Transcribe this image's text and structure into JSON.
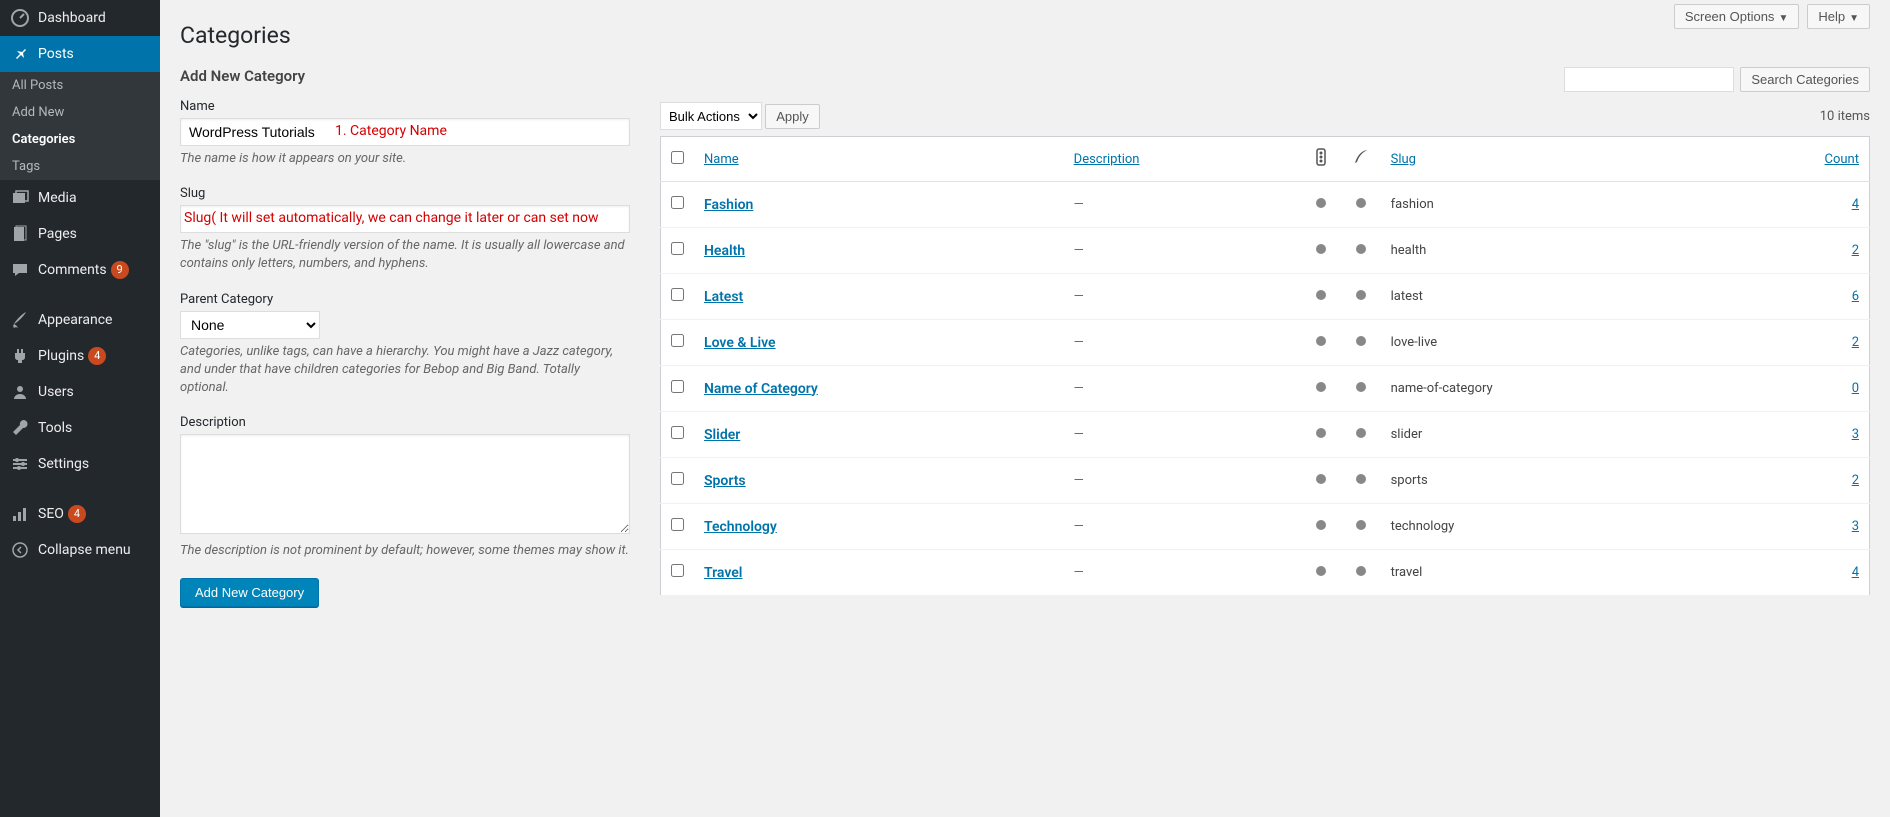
{
  "topbar": {
    "screen_options": "Screen Options",
    "help": "Help"
  },
  "sidebar": {
    "dashboard": "Dashboard",
    "posts": "Posts",
    "posts_sub": {
      "all": "All Posts",
      "add": "Add New",
      "categories": "Categories",
      "tags": "Tags"
    },
    "media": "Media",
    "pages": "Pages",
    "comments": "Comments",
    "comments_badge": "9",
    "appearance": "Appearance",
    "plugins": "Plugins",
    "plugins_badge": "4",
    "users": "Users",
    "tools": "Tools",
    "settings": "Settings",
    "seo": "SEO",
    "seo_badge": "4",
    "collapse": "Collapse menu"
  },
  "page": {
    "title": "Categories"
  },
  "form": {
    "heading": "Add New Category",
    "name_label": "Name",
    "name_value": "WordPress Tutorials",
    "name_annot": "1. Category Name",
    "name_desc": "The name is how it appears on your site.",
    "slug_label": "Slug",
    "slug_annot": "Slug( It will set automatically, we can change it later or can set now",
    "slug_desc": "The \"slug\" is the URL-friendly version of the name. It is usually all lowercase and contains only letters, numbers, and hyphens.",
    "parent_label": "Parent Category",
    "parent_value": "None",
    "parent_desc": "Categories, unlike tags, can have a hierarchy. You might have a Jazz category, and under that have children categories for Bebop and Big Band. Totally optional.",
    "desc_label": "Description",
    "desc_desc": "The description is not prominent by default; however, some themes may show it.",
    "submit": "Add New Category"
  },
  "table": {
    "search_btn": "Search Categories",
    "bulk_label": "Bulk Actions",
    "apply": "Apply",
    "total": "10 items",
    "cols": {
      "name": "Name",
      "description": "Description",
      "slug": "Slug",
      "count": "Count"
    },
    "rows": [
      {
        "name": "Fashion",
        "desc": "—",
        "slug": "fashion",
        "count": "4"
      },
      {
        "name": "Health",
        "desc": "—",
        "slug": "health",
        "count": "2"
      },
      {
        "name": "Latest",
        "desc": "—",
        "slug": "latest",
        "count": "6"
      },
      {
        "name": "Love & Live",
        "desc": "—",
        "slug": "love-live",
        "count": "2"
      },
      {
        "name": "Name of Category",
        "desc": "—",
        "slug": "name-of-category",
        "count": "0"
      },
      {
        "name": "Slider",
        "desc": "—",
        "slug": "slider",
        "count": "3"
      },
      {
        "name": "Sports",
        "desc": "—",
        "slug": "sports",
        "count": "2"
      },
      {
        "name": "Technology",
        "desc": "—",
        "slug": "technology",
        "count": "3"
      },
      {
        "name": "Travel",
        "desc": "—",
        "slug": "travel",
        "count": "4"
      }
    ]
  }
}
